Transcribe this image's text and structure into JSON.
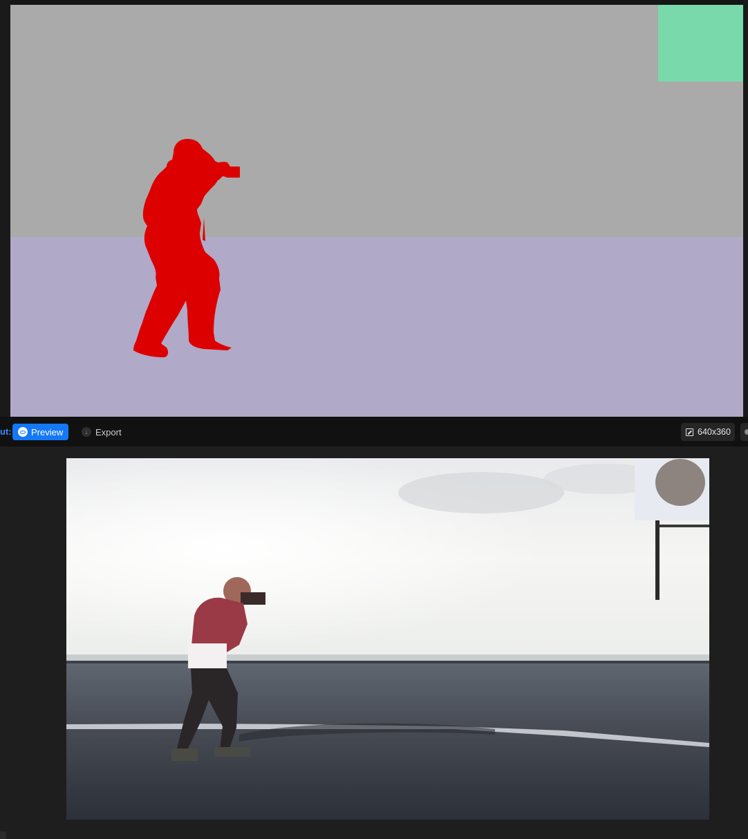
{
  "toolbar": {
    "label": "ut:",
    "preview_label": "Preview",
    "export_label": "Export",
    "resolution": "640x360"
  },
  "segmentation_map": {
    "sky_color": "#aaaaaa",
    "ground_color": "#b0a9c8",
    "figure_color": "#dd0000",
    "object_color": "#79d9aa"
  },
  "icons": {
    "preview": "eye-icon",
    "export": "download-icon",
    "resolution": "resize-icon",
    "more": "more-icon"
  },
  "colors": {
    "accent": "#1479f6",
    "toolbar_bg": "#111111",
    "panel_bg": "#1e1e1e"
  }
}
